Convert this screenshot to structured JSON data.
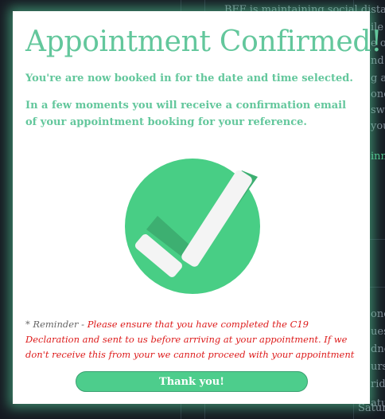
{
  "background": {
    "bullet_text": "BFF is maintaining social dista",
    "side_fragments": [
      "ile",
      "e on",
      "nd w",
      "g a",
      "once",
      "swi",
      "you",
      "inm",
      "one",
      "uese",
      "dne",
      "urs",
      "rid",
      "atur",
      "Satur"
    ]
  },
  "modal": {
    "title": "Appointment Confirmed!",
    "line1": "You're are now booked in for the date and time selected.",
    "line2": "In a few moments you will receive a confirmation email of your appointment booking for your reference.",
    "reminder_prefix": "* Reminder - ",
    "reminder_text": "Please ensure that you have completed the C19 Declaration and sent to us before arriving at your appointment. If we don't receive this from your we cannot proceed with your appointment",
    "button_label": "Thank you!",
    "check_icon": "check-circle-icon"
  },
  "colors": {
    "accent": "#63c79c",
    "button": "#4dcd8c",
    "circle": "#48ce85",
    "warning": "#dd1b1b",
    "backdrop": "#161a22",
    "glow": "#58d9a0"
  }
}
